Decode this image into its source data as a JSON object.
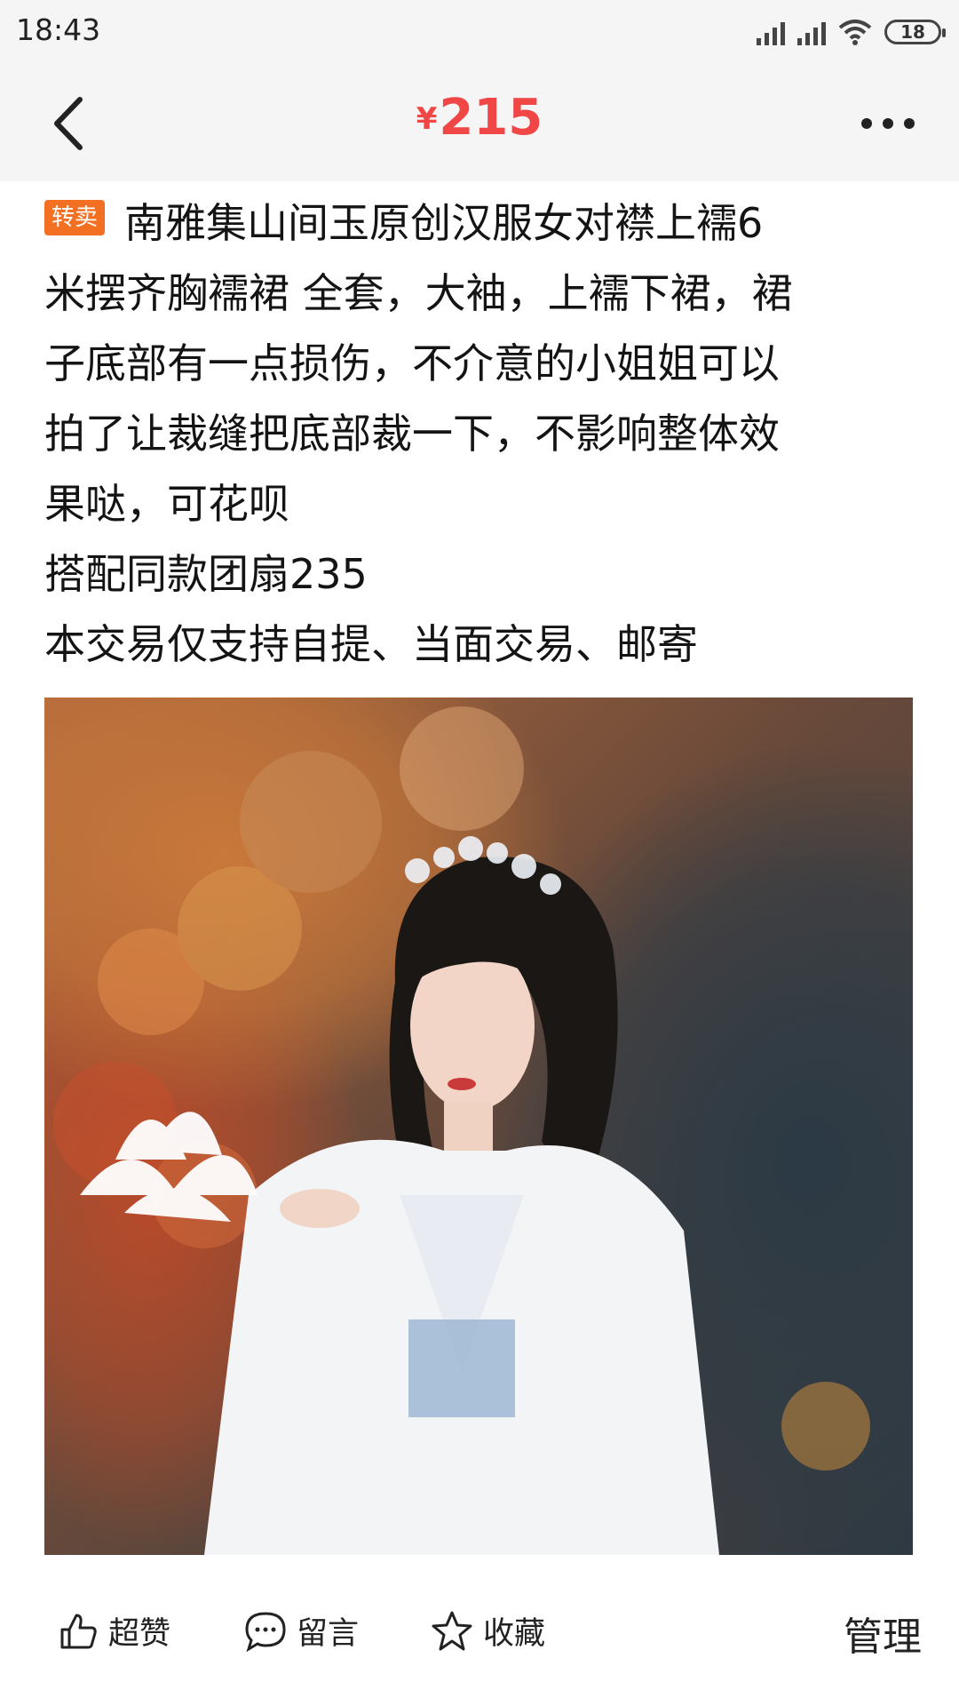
{
  "status_bar": {
    "time": "18:43",
    "battery": "18"
  },
  "header": {
    "currency": "¥",
    "price": "215"
  },
  "listing": {
    "tag": "转卖",
    "description_lines": [
      "南雅集山间玉原创汉服女对襟上襦6",
      "米摆齐胸襦裙 全套，大袖，上襦下裙，裙",
      "子底部有一点损伤，不介意的小姐姐可以",
      "拍了让裁缝把底部裁一下，不影响整体效",
      "果哒，可花呗"
    ],
    "extra_line": "搭配同款团扇235",
    "delivery_line": "本交易仅支持自提、当面交易、邮寄"
  },
  "actions": {
    "like_label": "超赞",
    "comment_label": "留言",
    "favorite_label": "收藏",
    "manage_label": "管理"
  },
  "icons": {
    "back": "chevron-left-icon",
    "more": "more-dots-icon",
    "like": "thumbs-up-icon",
    "comment": "chat-bubble-icon",
    "favorite": "star-icon"
  },
  "colors": {
    "price": "#f04646",
    "tag": "#f36f21",
    "header_bg": "#f5f5f5"
  }
}
